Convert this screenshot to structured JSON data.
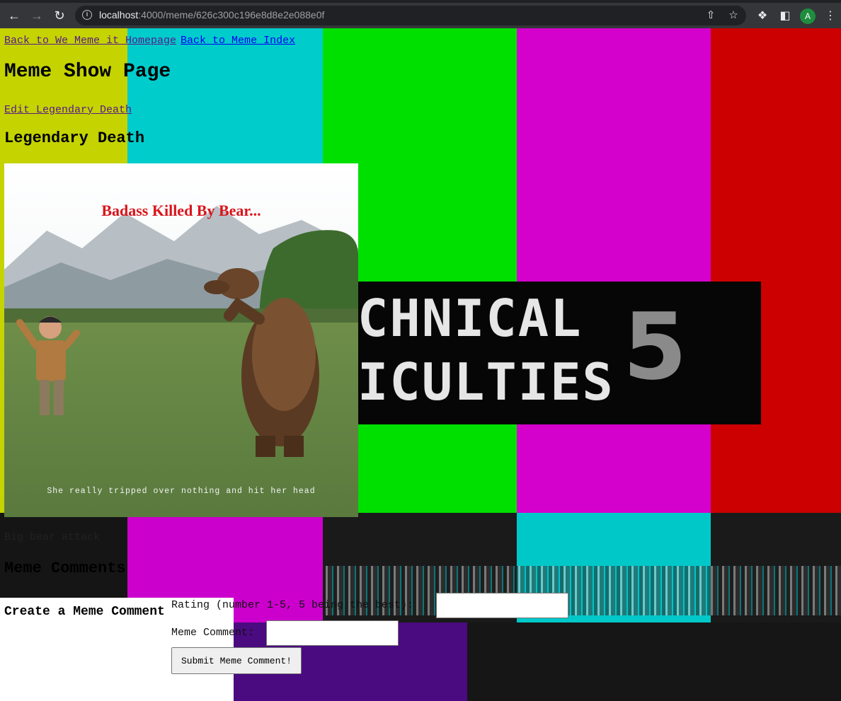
{
  "browser": {
    "url_host": "localhost",
    "url_path": ":4000/meme/626c300c196e8d8e2e088e0f",
    "avatar_letter": "A"
  },
  "background": {
    "top_line": "CHNICAL",
    "bottom_line": "ICULTIES",
    "channel": "5"
  },
  "nav_links": {
    "home": "Back to We Meme it Homepage",
    "index": "Back to Meme Index"
  },
  "page_title": "Meme Show Page",
  "edit_link": "Edit Legendary Death",
  "meme": {
    "name": "Legendary Death",
    "image_top_text": "Badass Killed By Bear...",
    "image_bottom_text": "She really tripped over nothing and hit her head",
    "caption": "Big bear attack"
  },
  "comments_heading": "Meme Comments",
  "form": {
    "heading": "Create a Meme Comment",
    "rating_label": "Rating (number 1-5, 5 being the best):",
    "rating_value": "",
    "comment_label": "Meme Comment:",
    "comment_value": "",
    "submit_label": "Submit Meme Comment!"
  },
  "colors": {
    "yellow": "#c5d300",
    "cyan": "#00cccc",
    "green": "#00e000",
    "magenta": "#d400cc",
    "red": "#cc0000",
    "blue": "#3a12cc",
    "link": "#0000ee",
    "visited": "#551a8b"
  }
}
